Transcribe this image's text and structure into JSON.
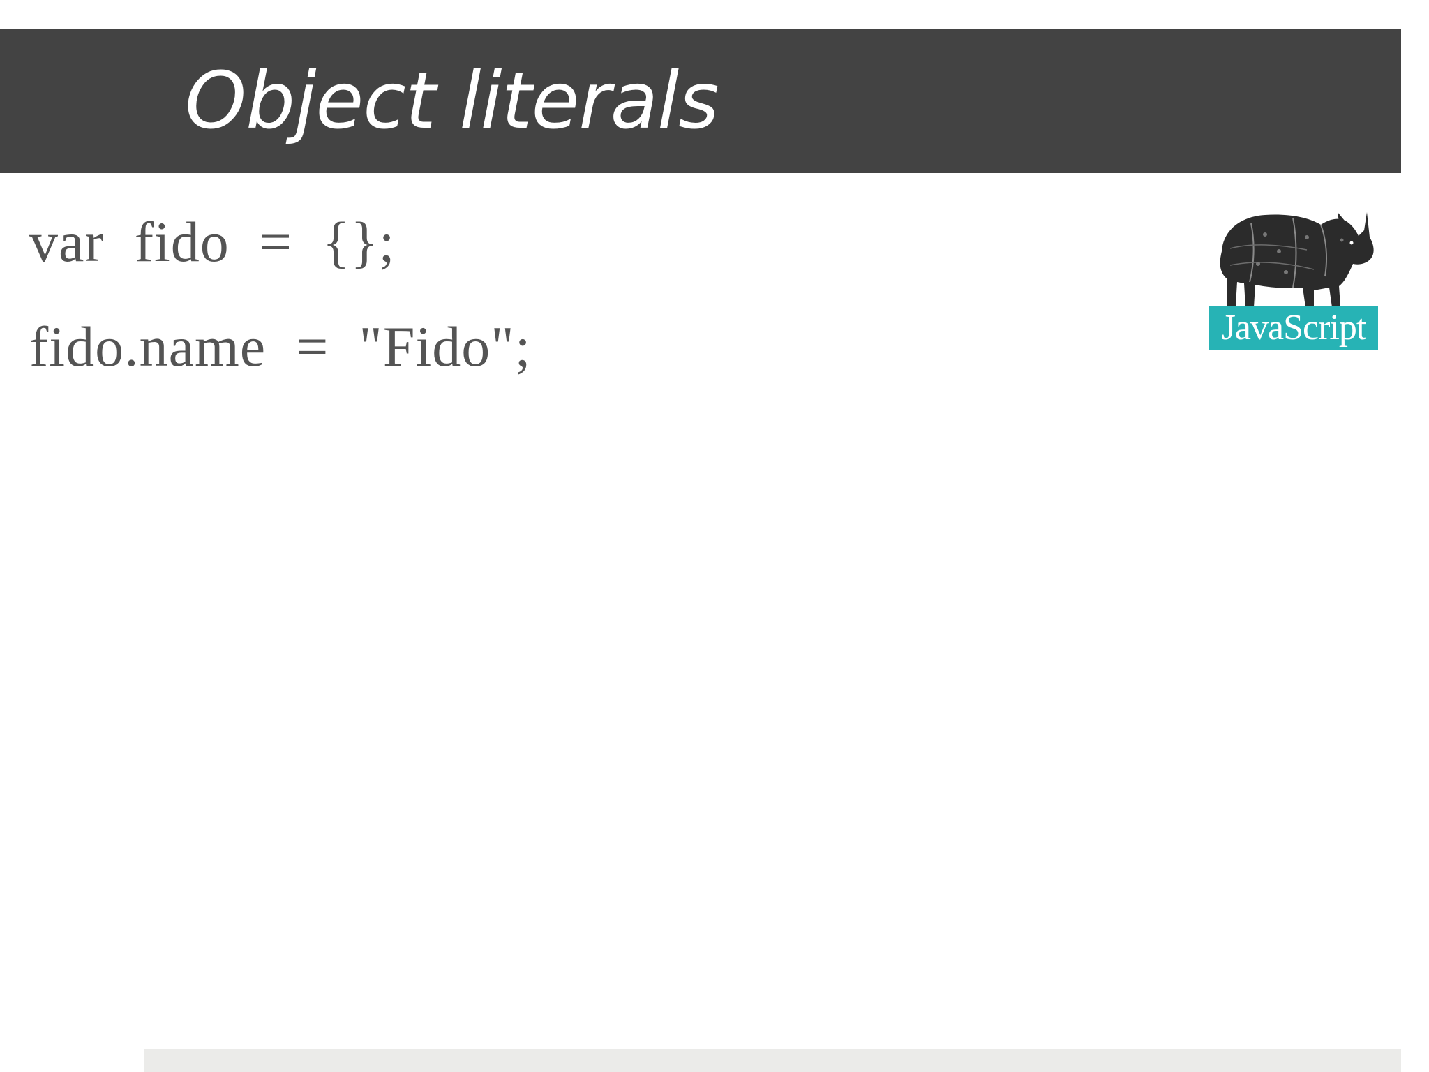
{
  "slide": {
    "title": "Object literals",
    "code_lines": [
      "var  fido  =  {};",
      "fido.name  =  \"Fido\";"
    ],
    "logo": {
      "icon": "rhino-icon",
      "label": "JavaScript"
    }
  },
  "colors": {
    "title_bar": "#434343",
    "title_text": "#ffffff",
    "code_text": "#545454",
    "logo_label_bg": "#27b3b5",
    "footer_band": "#ebebe9"
  }
}
